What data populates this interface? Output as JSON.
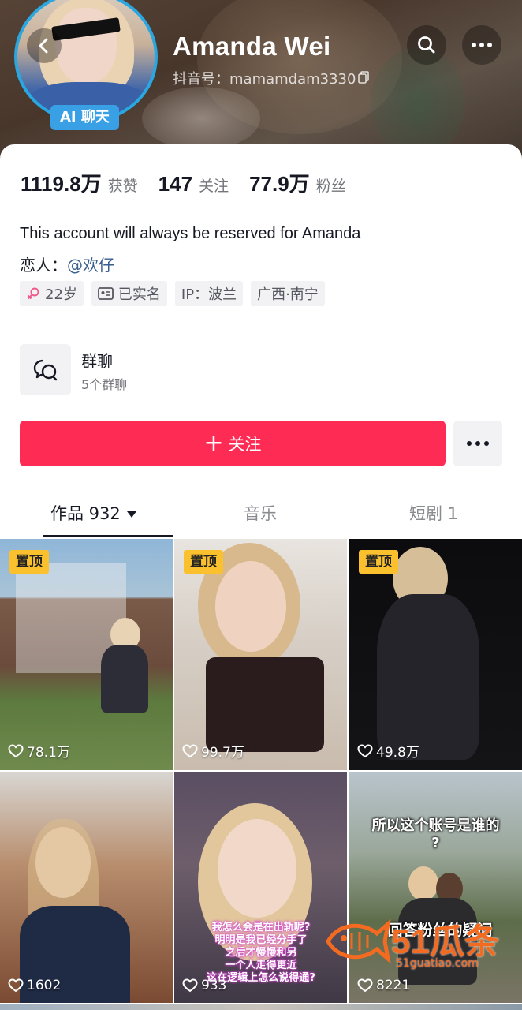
{
  "header": {
    "name": "Amanda Wei",
    "douyin_id": "抖音号：mamamdam3330",
    "ai_badge": "AI 聊天"
  },
  "stats": [
    {
      "value": "1119.8万",
      "label": "获赞"
    },
    {
      "value": "147",
      "label": "关注"
    },
    {
      "value": "77.9万",
      "label": "粉丝"
    }
  ],
  "bio": {
    "line1": "This account will always be reserved for Amanda",
    "lover_prefix": "恋人：",
    "lover_mention": "@欢仔"
  },
  "tags": [
    "22岁",
    "已实名",
    "IP：波兰",
    "广西·南宁"
  ],
  "group": {
    "title": "群聊",
    "subtitle": "5个群聊"
  },
  "actions": {
    "follow_label": "关注"
  },
  "tabs": [
    {
      "label": "作品 932",
      "active": true
    },
    {
      "label": "音乐",
      "active": false
    },
    {
      "label": "短剧 1",
      "active": false
    }
  ],
  "videos": [
    {
      "pinned": "置顶",
      "likes": "78.1万"
    },
    {
      "pinned": "置顶",
      "likes": "99.7万"
    },
    {
      "pinned": "置顶",
      "likes": "49.8万"
    },
    {
      "pinned": "",
      "likes": "1602"
    },
    {
      "pinned": "",
      "likes": "933",
      "overlay": [
        "我怎么会是在出轨呢?",
        "明明是我已经分手了",
        "之后才慢慢和另",
        "一个人走得更近",
        "这在逻辑上怎么说得通?"
      ]
    },
    {
      "pinned": "",
      "likes": "8221",
      "overlay_top": "所以这个账号是谁的",
      "overlay_q": "?",
      "overlay_bottom": "回答粉丝的疑问"
    }
  ],
  "watermark": {
    "big": "51瓜条",
    "url": "51guatiao.com"
  },
  "colors": {
    "follow": "#fe2c55",
    "pin": "#fbc02d",
    "ai_badge": "#3aa0e6",
    "mention": "#385d8f"
  }
}
